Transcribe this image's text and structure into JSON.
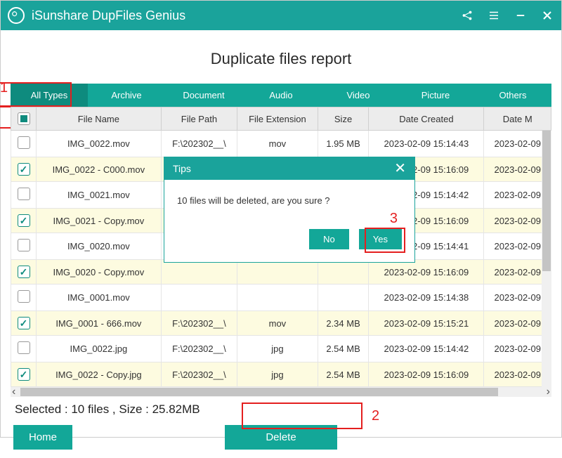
{
  "app": {
    "title": "iSunshare DupFiles Genius"
  },
  "page": {
    "heading": "Duplicate files report"
  },
  "tabs": [
    "All Types",
    "Archive",
    "Document",
    "Audio",
    "Video",
    "Picture",
    "Others"
  ],
  "columns": [
    "File Name",
    "File Path",
    "File Extension",
    "Size",
    "Date Created",
    "Date M"
  ],
  "rows": [
    {
      "checked": false,
      "name": "IMG_0022.mov",
      "path": "F:\\202302__\\",
      "ext": "mov",
      "size": "1.95 MB",
      "created": "2023-02-09 15:14:43",
      "modified": "2023-02-09"
    },
    {
      "checked": true,
      "name": "IMG_0022 - C000.mov",
      "path": "",
      "ext": "",
      "size": "",
      "created": "2023-02-09 15:16:09",
      "modified": "2023-02-09"
    },
    {
      "checked": false,
      "name": "IMG_0021.mov",
      "path": "",
      "ext": "",
      "size": "",
      "created": "2023-02-09 15:14:42",
      "modified": "2023-02-09"
    },
    {
      "checked": true,
      "name": "IMG_0021 - Copy.mov",
      "path": "",
      "ext": "",
      "size": "",
      "created": "2023-02-09 15:16:09",
      "modified": "2023-02-09"
    },
    {
      "checked": false,
      "name": "IMG_0020.mov",
      "path": "",
      "ext": "",
      "size": "",
      "created": "2023-02-09 15:14:41",
      "modified": "2023-02-09"
    },
    {
      "checked": true,
      "name": "IMG_0020 - Copy.mov",
      "path": "",
      "ext": "",
      "size": "",
      "created": "2023-02-09 15:16:09",
      "modified": "2023-02-09"
    },
    {
      "checked": false,
      "name": "IMG_0001.mov",
      "path": "",
      "ext": "",
      "size": "",
      "created": "2023-02-09 15:14:38",
      "modified": "2023-02-09"
    },
    {
      "checked": true,
      "name": "IMG_0001 - 666.mov",
      "path": "F:\\202302__\\",
      "ext": "mov",
      "size": "2.34 MB",
      "created": "2023-02-09 15:15:21",
      "modified": "2023-02-09"
    },
    {
      "checked": false,
      "name": "IMG_0022.jpg",
      "path": "F:\\202302__\\",
      "ext": "jpg",
      "size": "2.54 MB",
      "created": "2023-02-09 15:14:42",
      "modified": "2023-02-09"
    },
    {
      "checked": true,
      "name": "IMG_0022 - Copy.jpg",
      "path": "F:\\202302__\\",
      "ext": "jpg",
      "size": "2.54 MB",
      "created": "2023-02-09 15:16:09",
      "modified": "2023-02-09"
    }
  ],
  "status": "Selected : 10  files ,  Size : 25.82MB",
  "buttons": {
    "home": "Home",
    "delete": "Delete"
  },
  "dialog": {
    "title": "Tips",
    "message": "10 files will be deleted, are you sure ?",
    "no": "No",
    "yes": "Yes"
  },
  "annotations": {
    "one": "1",
    "two": "2",
    "three": "3"
  }
}
